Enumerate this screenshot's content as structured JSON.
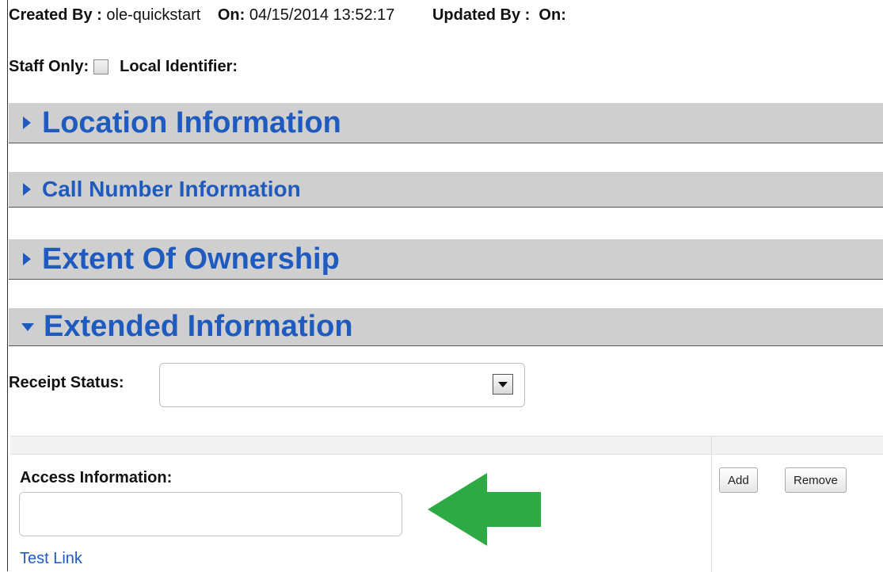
{
  "meta": {
    "created_by_label": "Created By :",
    "created_by_value": "ole-quickstart",
    "on_label": "On:",
    "on_value": "04/15/2014 13:52:17",
    "updated_by_label": "Updated By :",
    "on2_label": "On:"
  },
  "staff": {
    "staff_only_label": "Staff Only:",
    "local_identifier_label": "Local Identifier:"
  },
  "sections": [
    {
      "title": "Location Information",
      "expanded": false
    },
    {
      "title": "Call Number Information",
      "expanded": false
    },
    {
      "title": "Extent Of Ownership",
      "expanded": false
    },
    {
      "title": "Extended Information",
      "expanded": true
    }
  ],
  "receipt": {
    "label": "Receipt Status:",
    "selected": ""
  },
  "access": {
    "label": "Access Information:",
    "value": "",
    "link_text": "Test Link",
    "add_label": "Add",
    "remove_label": "Remove"
  },
  "colors": {
    "section_title": "#1f5bbf",
    "section_bg": "#cfcfcf",
    "arrow_green": "#2eaa44"
  }
}
